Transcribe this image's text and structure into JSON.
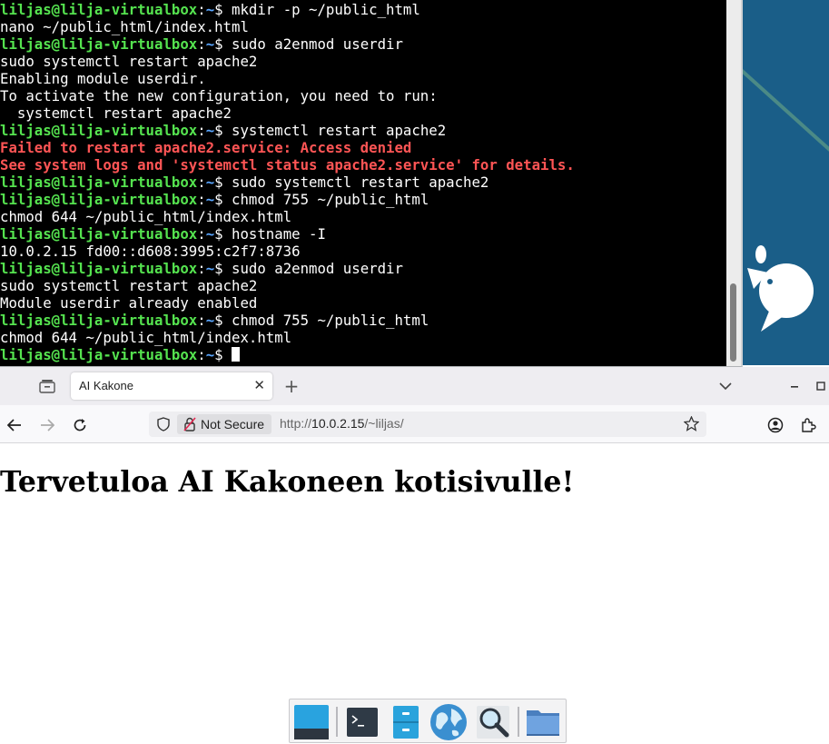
{
  "terminal": {
    "prompt_user": "liljas@lilja-virtualbox",
    "prompt_path": "~",
    "lines": [
      {
        "kind": "prompt",
        "cmd": "mkdir -p ~/public_html"
      },
      {
        "kind": "out",
        "text": "nano ~/public_html/index.html"
      },
      {
        "kind": "prompt",
        "cmd": "sudo a2enmod userdir"
      },
      {
        "kind": "out",
        "text": "sudo systemctl restart apache2"
      },
      {
        "kind": "out",
        "text": "Enabling module userdir."
      },
      {
        "kind": "out",
        "text": "To activate the new configuration, you need to run:"
      },
      {
        "kind": "out",
        "text": "  systemctl restart apache2"
      },
      {
        "kind": "prompt",
        "cmd": "systemctl restart apache2"
      },
      {
        "kind": "err",
        "text": "Failed to restart apache2.service: Access denied"
      },
      {
        "kind": "err",
        "text": "See system logs and 'systemctl status apache2.service' for details."
      },
      {
        "kind": "prompt",
        "cmd": "sudo systemctl restart apache2"
      },
      {
        "kind": "prompt",
        "cmd": "chmod 755 ~/public_html"
      },
      {
        "kind": "out",
        "text": "chmod 644 ~/public_html/index.html"
      },
      {
        "kind": "prompt",
        "cmd": "hostname -I"
      },
      {
        "kind": "out",
        "text": "10.0.2.15 fd00::d608:3995:c2f7:8736"
      },
      {
        "kind": "prompt",
        "cmd": "sudo a2enmod userdir"
      },
      {
        "kind": "out",
        "text": "sudo systemctl restart apache2"
      },
      {
        "kind": "out",
        "text": "Module userdir already enabled"
      },
      {
        "kind": "prompt",
        "cmd": "chmod 755 ~/public_html"
      },
      {
        "kind": "out",
        "text": "chmod 644 ~/public_html/index.html"
      },
      {
        "kind": "prompt",
        "cmd": "",
        "cursor": true
      }
    ]
  },
  "browser": {
    "tab_title": "AI Kakone",
    "not_secure_label": "Not Secure",
    "url_scheme": "http://",
    "url_host": "10.0.2.15",
    "url_path": "/~liljas/",
    "page_heading": "Tervetuloa AI Kakoneen kotisivulle!"
  },
  "taskbar": {
    "items": [
      "show-desktop",
      "terminal",
      "file-manager",
      "web-browser",
      "app-finder",
      "home-folder"
    ]
  },
  "colors": {
    "prompt_user": "#55e34f",
    "prompt_path": "#5aa6ff",
    "error_text": "#ff5555",
    "wallpaper": "#1a5e88"
  }
}
